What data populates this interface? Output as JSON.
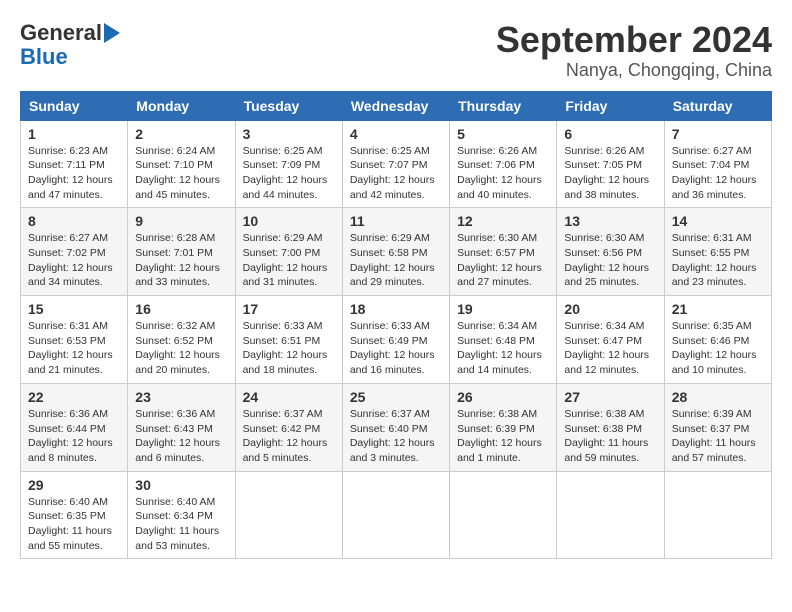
{
  "logo": {
    "line1": "General",
    "line2": "Blue"
  },
  "title": "September 2024",
  "subtitle": "Nanya, Chongqing, China",
  "days_of_week": [
    "Sunday",
    "Monday",
    "Tuesday",
    "Wednesday",
    "Thursday",
    "Friday",
    "Saturday"
  ],
  "weeks": [
    [
      {
        "day": 1,
        "sunrise": "6:23 AM",
        "sunset": "7:11 PM",
        "daylight": "12 hours and 47 minutes."
      },
      {
        "day": 2,
        "sunrise": "6:24 AM",
        "sunset": "7:10 PM",
        "daylight": "12 hours and 45 minutes."
      },
      {
        "day": 3,
        "sunrise": "6:25 AM",
        "sunset": "7:09 PM",
        "daylight": "12 hours and 44 minutes."
      },
      {
        "day": 4,
        "sunrise": "6:25 AM",
        "sunset": "7:07 PM",
        "daylight": "12 hours and 42 minutes."
      },
      {
        "day": 5,
        "sunrise": "6:26 AM",
        "sunset": "7:06 PM",
        "daylight": "12 hours and 40 minutes."
      },
      {
        "day": 6,
        "sunrise": "6:26 AM",
        "sunset": "7:05 PM",
        "daylight": "12 hours and 38 minutes."
      },
      {
        "day": 7,
        "sunrise": "6:27 AM",
        "sunset": "7:04 PM",
        "daylight": "12 hours and 36 minutes."
      }
    ],
    [
      {
        "day": 8,
        "sunrise": "6:27 AM",
        "sunset": "7:02 PM",
        "daylight": "12 hours and 34 minutes."
      },
      {
        "day": 9,
        "sunrise": "6:28 AM",
        "sunset": "7:01 PM",
        "daylight": "12 hours and 33 minutes."
      },
      {
        "day": 10,
        "sunrise": "6:29 AM",
        "sunset": "7:00 PM",
        "daylight": "12 hours and 31 minutes."
      },
      {
        "day": 11,
        "sunrise": "6:29 AM",
        "sunset": "6:58 PM",
        "daylight": "12 hours and 29 minutes."
      },
      {
        "day": 12,
        "sunrise": "6:30 AM",
        "sunset": "6:57 PM",
        "daylight": "12 hours and 27 minutes."
      },
      {
        "day": 13,
        "sunrise": "6:30 AM",
        "sunset": "6:56 PM",
        "daylight": "12 hours and 25 minutes."
      },
      {
        "day": 14,
        "sunrise": "6:31 AM",
        "sunset": "6:55 PM",
        "daylight": "12 hours and 23 minutes."
      }
    ],
    [
      {
        "day": 15,
        "sunrise": "6:31 AM",
        "sunset": "6:53 PM",
        "daylight": "12 hours and 21 minutes."
      },
      {
        "day": 16,
        "sunrise": "6:32 AM",
        "sunset": "6:52 PM",
        "daylight": "12 hours and 20 minutes."
      },
      {
        "day": 17,
        "sunrise": "6:33 AM",
        "sunset": "6:51 PM",
        "daylight": "12 hours and 18 minutes."
      },
      {
        "day": 18,
        "sunrise": "6:33 AM",
        "sunset": "6:49 PM",
        "daylight": "12 hours and 16 minutes."
      },
      {
        "day": 19,
        "sunrise": "6:34 AM",
        "sunset": "6:48 PM",
        "daylight": "12 hours and 14 minutes."
      },
      {
        "day": 20,
        "sunrise": "6:34 AM",
        "sunset": "6:47 PM",
        "daylight": "12 hours and 12 minutes."
      },
      {
        "day": 21,
        "sunrise": "6:35 AM",
        "sunset": "6:46 PM",
        "daylight": "12 hours and 10 minutes."
      }
    ],
    [
      {
        "day": 22,
        "sunrise": "6:36 AM",
        "sunset": "6:44 PM",
        "daylight": "12 hours and 8 minutes."
      },
      {
        "day": 23,
        "sunrise": "6:36 AM",
        "sunset": "6:43 PM",
        "daylight": "12 hours and 6 minutes."
      },
      {
        "day": 24,
        "sunrise": "6:37 AM",
        "sunset": "6:42 PM",
        "daylight": "12 hours and 5 minutes."
      },
      {
        "day": 25,
        "sunrise": "6:37 AM",
        "sunset": "6:40 PM",
        "daylight": "12 hours and 3 minutes."
      },
      {
        "day": 26,
        "sunrise": "6:38 AM",
        "sunset": "6:39 PM",
        "daylight": "12 hours and 1 minute."
      },
      {
        "day": 27,
        "sunrise": "6:38 AM",
        "sunset": "6:38 PM",
        "daylight": "11 hours and 59 minutes."
      },
      {
        "day": 28,
        "sunrise": "6:39 AM",
        "sunset": "6:37 PM",
        "daylight": "11 hours and 57 minutes."
      }
    ],
    [
      {
        "day": 29,
        "sunrise": "6:40 AM",
        "sunset": "6:35 PM",
        "daylight": "11 hours and 55 minutes."
      },
      {
        "day": 30,
        "sunrise": "6:40 AM",
        "sunset": "6:34 PM",
        "daylight": "11 hours and 53 minutes."
      },
      null,
      null,
      null,
      null,
      null
    ]
  ]
}
